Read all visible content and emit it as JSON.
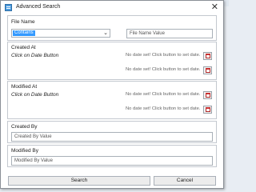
{
  "window": {
    "title": "Advanced Search",
    "close_glyph": "✕",
    "icon": "app-icon"
  },
  "file_name": {
    "label": "File Name",
    "operator": "Contains",
    "operator_chevron": "⌄",
    "value_placeholder": "File Name Value"
  },
  "created_at": {
    "label": "Created At",
    "hint": "Click on Date Button",
    "start_text": "No date set! Click button to set date.",
    "end_text": "No date set! Click button to set date."
  },
  "modified_at": {
    "label": "Modified At",
    "hint": "Click on Date Button",
    "start_text": "No date set! Click button to set date.",
    "end_text": "No date set! Click button to set date."
  },
  "created_by": {
    "label": "Created By",
    "placeholder": "Created By Value"
  },
  "modified_by": {
    "label": "Modified By",
    "placeholder": "Modified By Value"
  },
  "buttons": {
    "search": "Search",
    "cancel": "Cancel"
  },
  "colors": {
    "selection": "#3399ff",
    "calendar_icon": "#c83232"
  }
}
